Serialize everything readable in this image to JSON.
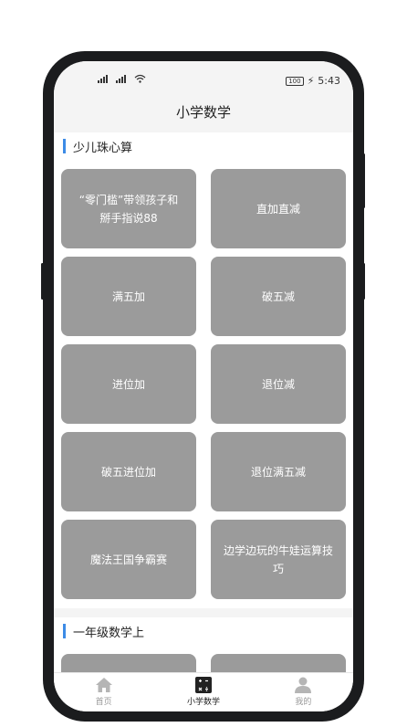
{
  "status_bar": {
    "time": "5:43",
    "battery": "100",
    "signal": "all all"
  },
  "header": {
    "title": "小学数学"
  },
  "sections": [
    {
      "title": "少儿珠心算",
      "cards": [
        "“零门槛”带领孩子和掰手指说88",
        "直加直减",
        "满五加",
        "破五减",
        "进位加",
        "退位减",
        "破五进位加",
        "退位满五减",
        "魔法王国争霸赛",
        "边学边玩的牛娃运算技巧"
      ]
    },
    {
      "title": "一年级数学上",
      "cards": [
        "",
        ""
      ]
    }
  ],
  "tabbar": {
    "items": [
      {
        "label": "首页",
        "icon": "home-icon"
      },
      {
        "label": "小学数学",
        "icon": "calculator-icon",
        "active": true
      },
      {
        "label": "我的",
        "icon": "user-icon"
      }
    ]
  },
  "colors": {
    "accent": "#3d8be6",
    "card": "#9b9b9b"
  }
}
